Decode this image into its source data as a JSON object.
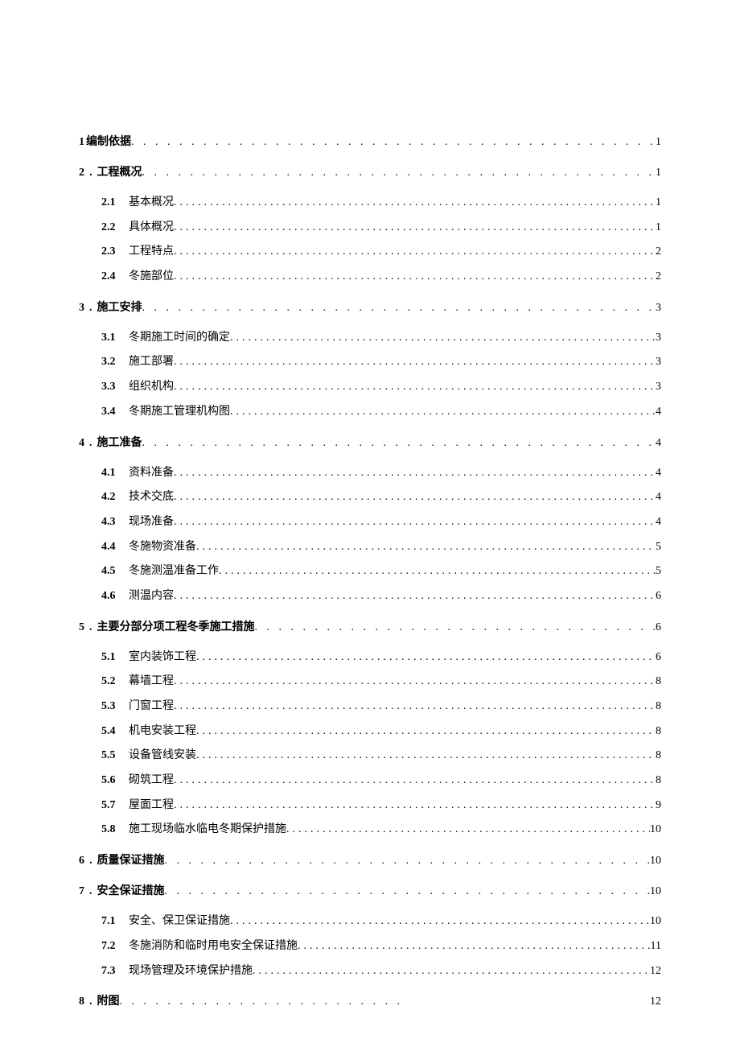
{
  "toc": [
    {
      "num": "1",
      "title": "编制依据",
      "pg": "1",
      "noDot": true,
      "subs": []
    },
    {
      "num": "2",
      "title": "工程概况",
      "pg": "1",
      "subs": [
        {
          "num": "2.1",
          "title": "基本概况",
          "pg": "1"
        },
        {
          "num": "2.2",
          "title": "具体概况",
          "pg": "1"
        },
        {
          "num": "2.3",
          "title": "工程特点",
          "pg": "2"
        },
        {
          "num": "2.4",
          "title": "冬施部位",
          "pg": "2"
        }
      ]
    },
    {
      "num": "3",
      "title": "施工安排",
      "pg": "3",
      "subs": [
        {
          "num": "3.1",
          "title": "冬期施工时间的确定",
          "pg": "3"
        },
        {
          "num": "3.2",
          "title": "施工部署",
          "pg": "3"
        },
        {
          "num": "3.3",
          "title": "组织机构",
          "pg": "3"
        },
        {
          "num": "3.4",
          "title": "冬期施工管理机构图",
          "pg": "4"
        }
      ]
    },
    {
      "num": "4",
      "title": "施工准备",
      "pg": "4",
      "subs": [
        {
          "num": "4.1",
          "title": "资料准备",
          "pg": "4"
        },
        {
          "num": "4.2",
          "title": "技术交底",
          "pg": "4"
        },
        {
          "num": "4.3",
          "title": "现场准备",
          "pg": "4"
        },
        {
          "num": "4.4",
          "title": "冬施物资准备",
          "pg": "5"
        },
        {
          "num": "4.5",
          "title": "冬施测温准备工作",
          "pg": "5"
        },
        {
          "num": "4.6",
          "title": "测温内容",
          "pg": "6"
        }
      ]
    },
    {
      "num": "5",
      "title": "主要分部分项工程冬季施工措施",
      "pg": "6",
      "subs": [
        {
          "num": "5.1",
          "title": "室内装饰工程",
          "pg": "6"
        },
        {
          "num": "5.2",
          "title": "幕墙工程",
          "pg": "8"
        },
        {
          "num": "5.3",
          "title": "门窗工程",
          "pg": "8"
        },
        {
          "num": "5.4",
          "title": "机电安装工程",
          "pg": "8"
        },
        {
          "num": "5.5",
          "title": "设备管线安装",
          "pg": "8"
        },
        {
          "num": "5.6",
          "title": "砌筑工程",
          "pg": "8"
        },
        {
          "num": "5.7",
          "title": "屋面工程",
          "pg": "9"
        },
        {
          "num": "5.8",
          "title": "施工现场临水临电冬期保护措施",
          "pg": "10"
        }
      ]
    },
    {
      "num": "6",
      "title": "质量保证措施",
      "pg": "10",
      "subs": []
    },
    {
      "num": "7",
      "title": "安全保证措施",
      "pg": "10",
      "subs": [
        {
          "num": "7.1",
          "title": "安全、保卫保证措施",
          "pg": "10"
        },
        {
          "num": "7.2",
          "title": "冬施消防和临时用电安全保证措施",
          "pg": "11"
        },
        {
          "num": "7.3",
          "title": "现场管理及环境保护措施",
          "pg": "12"
        }
      ]
    },
    {
      "num": "8",
      "title": "附图",
      "pg": "12",
      "short": true,
      "subs": []
    }
  ],
  "dotfill": ". . . . . . . . . . . . . . . . . . . . . . . . . . . . . . . . . . . . . . . . . . . . . . . . . . . . . . . . . . . . . . . . . . . . . . . . . . . . . . . . . . . . . . . . . . . . . . . . . . . .",
  "dotfill2": ".................................................................................................................................................."
}
